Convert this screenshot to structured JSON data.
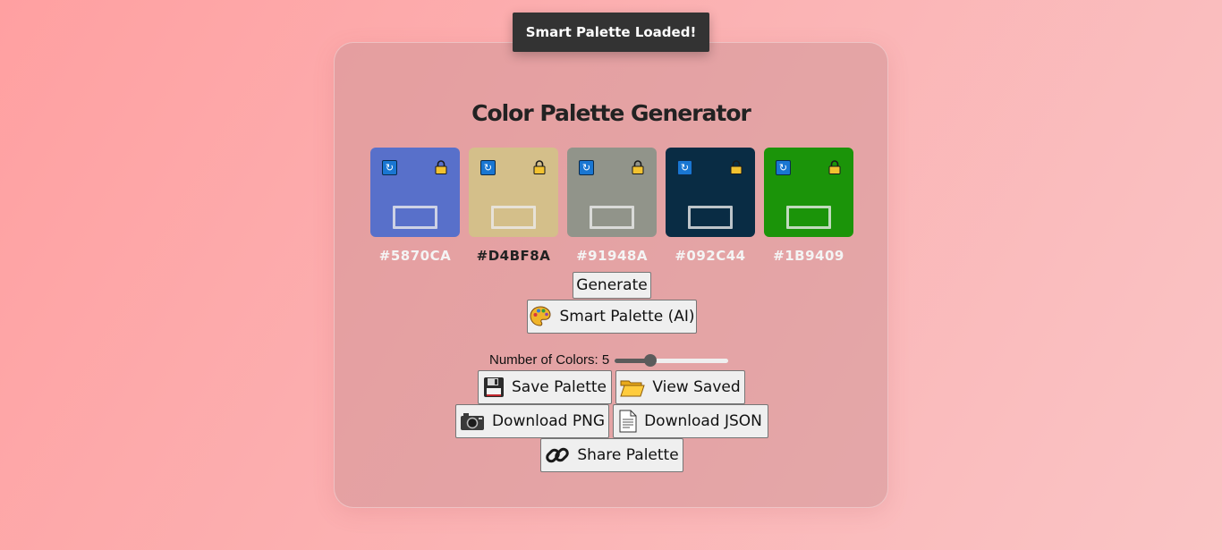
{
  "toast": {
    "message": "Smart Palette Loaded!"
  },
  "app": {
    "title": "Color Palette Generator"
  },
  "swatches": [
    {
      "hex": "#5870CA",
      "color": "#5870CA",
      "text_dark": false
    },
    {
      "hex": "#D4BF8A",
      "color": "#D4BF8A",
      "text_dark": true
    },
    {
      "hex": "#91948A",
      "color": "#91948A",
      "text_dark": false
    },
    {
      "hex": "#092C44",
      "color": "#092C44",
      "text_dark": false
    },
    {
      "hex": "#1B9409",
      "color": "#1B9409",
      "text_dark": false
    }
  ],
  "icons": {
    "refresh": "refresh-icon",
    "lock": "lock-icon"
  },
  "buttons": {
    "generate": "Generate",
    "smart_palette": "Smart Palette (AI)",
    "save_palette": "Save Palette",
    "view_saved": "View Saved",
    "download_png": "Download PNG",
    "download_json": "Download JSON",
    "share_palette": "Share Palette"
  },
  "slider": {
    "label": "Number of Colors:",
    "value": "5",
    "min": 3,
    "max": 10,
    "current": 5
  },
  "colors": {
    "accent_refresh": "#1976d2",
    "lock": "#f2c230",
    "toast_bg": "#333333"
  }
}
